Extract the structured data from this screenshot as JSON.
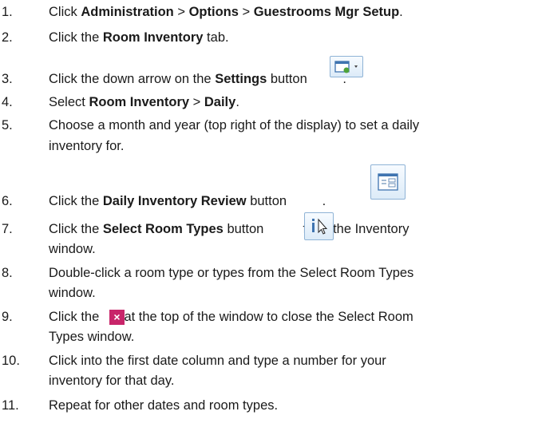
{
  "steps": [
    {
      "num": "1.",
      "parts": {
        "a": "Click ",
        "b": "Administration",
        "c": " > ",
        "d": "Options",
        "e": " > ",
        "f": "Guestrooms Mgr Setup",
        "g": "."
      }
    },
    {
      "num": "2.",
      "parts": {
        "a": "Click the ",
        "b": "Room Inventory",
        "c": " tab."
      }
    },
    {
      "num": "3.",
      "parts": {
        "a": "Click the down arrow on the ",
        "b": "Settings",
        "c": " button ",
        "d": "."
      }
    },
    {
      "num": "4.",
      "parts": {
        "a": "Select ",
        "b": "Room Inventory",
        "c": " > ",
        "d": "Daily",
        "e": "."
      }
    },
    {
      "num": "5.",
      "line1": "Choose a month and year (top right of the display) to set a daily",
      "line2": "inventory for."
    },
    {
      "num": "6.",
      "parts": {
        "a": "Click the ",
        "b": "Daily Inventory Review",
        "c": " button ",
        "d": "."
      }
    },
    {
      "num": "7.",
      "parts": {
        "a": "Click the ",
        "b": "Select Room Types",
        "c": " button ",
        "d": " from the Inventory"
      },
      "line2": "window."
    },
    {
      "num": "8.",
      "line1": "Double-click a room type or types from the Select Room Types",
      "line2": "window."
    },
    {
      "num": "9.",
      "line1a": "Click the ",
      "line1b": " at the top of the window to close the Select Room",
      "line2": "Types window."
    },
    {
      "num": "10.",
      "line1": "Click into the first date column and type a number for your",
      "line2": "inventory for that day."
    },
    {
      "num": "11.",
      "line1": "Repeat for other dates and room types."
    }
  ],
  "icons": {
    "settings": "settings-dropdown-icon",
    "daily_review": "daily-inventory-review-icon",
    "select_room_types": "select-room-types-icon",
    "close": "close-icon",
    "close_glyph": "×"
  },
  "colors": {
    "icon_border": "#8fb3d6",
    "close_bg": "#c8256a"
  }
}
